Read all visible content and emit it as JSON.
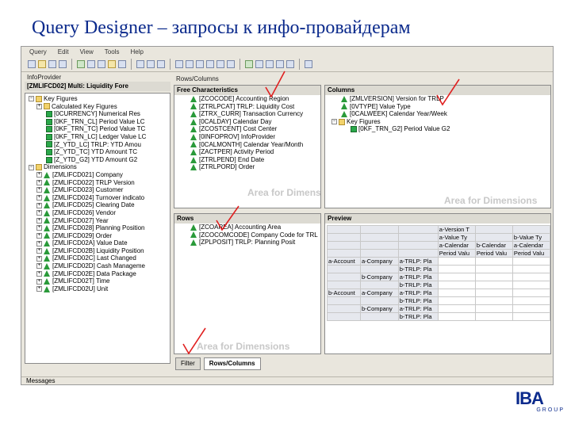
{
  "slide_title": "Query Designer – запросы к инфо-провайдерам",
  "menu": [
    "Query",
    "Edit",
    "View",
    "Tools",
    "Help"
  ],
  "infoprovider": {
    "header": "InfoProvider",
    "title": "[ZMLIFCD02] Multi: Liquidity Fore",
    "key_figures_label": "Key Figures",
    "key_figures": [
      "Calculated Key Figures",
      "[0CURRENCY] Numerical Res",
      "[0KF_TRN_CL] Period Value LC",
      "[0KF_TRN_TC] Period Value TC",
      "[0KF_TRN_LC] Ledger Value LC",
      "[Z_YTD_LC] TRLP: YTD Amou",
      "[Z_YTD_TC] YTD Amount TC",
      "[Z_YTD_G2] YTD Amount G2"
    ],
    "dimensions_label": "Dimensions",
    "dimensions": [
      "[ZMLIFCD021] Company",
      "[ZMLIFCD022] TRLP Version",
      "[ZMLIFCD023] Customer",
      "[ZMLIFCD024] Turnover indicato",
      "[ZMLIFCD025] Clearing Date",
      "[ZMLIFCD026] Vendor",
      "[ZMLIFCD027] Year",
      "[ZMLIFCD028] Planning Position",
      "[ZMLIFCD029] Order",
      "[ZMLIFCD02A] Value Date",
      "[ZMLIFCD02B] Liquidity Position",
      "[ZMLIFCD02C] Last Changed",
      "[ZMLIFCD02D] Cash Manageme",
      "[ZMLIFCD02E] Data Package",
      "[ZMLIFCD02T] Time",
      "[ZMLIFCD02U] Unit"
    ]
  },
  "rows_columns": {
    "header": "Rows/Columns",
    "free_title": "Free Characteristics",
    "free": [
      "[ZCOCODE] Accounting Region",
      "[ZTRLPCAT] TRLP: Liquidity Cost",
      "[ZTRX_CURR] Transaction Currency",
      "[0CALDAY] Calendar Day",
      "[ZCOSTCENT] Cost Center",
      "[0INFOPROV] InfoProvider",
      "[0CALMONTH] Calendar Year/Month",
      "[ZACTPER] Activity Period",
      "[ZTRLPEND] End Date",
      "[ZTRLPORD] Order"
    ],
    "free_area_label": "Area for Dimensions",
    "columns_title": "Columns",
    "columns": [
      "[ZMLVERSION] Version for TRLP",
      "[0VTYPE] Value Type",
      "[0CALWEEK] Calendar Year/Week"
    ],
    "columns_kf_label": "Key Figures",
    "columns_kf": [
      "[0KF_TRN_G2] Period Value G2"
    ],
    "columns_area_label": "Area for Dimensions",
    "rows_title": "Rows",
    "rows": [
      "[ZCOAREA] Accounting Area",
      "[ZCOCOMCODE] Company Code for TRL",
      "[ZPLPOSIT] TRLP: Planning Posit"
    ],
    "rows_area_label": "Area for Dimensions",
    "preview_title": "Preview"
  },
  "preview": {
    "top": [
      [
        "",
        "",
        "",
        "a-Version T",
        "",
        ""
      ],
      [
        "",
        "",
        "",
        "a-Value Ty",
        "",
        "b-Value Ty"
      ],
      [
        "",
        "",
        "",
        "a-Calendar",
        "b-Calendar",
        "a-Calendar"
      ],
      [
        "",
        "",
        "",
        "Period Valu",
        "Period Valu",
        "Period Valu"
      ]
    ],
    "rows": [
      [
        "a-Account",
        "a-Company",
        "a-TRLP: Pla",
        "",
        "",
        ""
      ],
      [
        "",
        "",
        "b-TRLP: Pla",
        "",
        "",
        ""
      ],
      [
        "",
        "b-Company",
        "a-TRLP: Pla",
        "",
        "",
        ""
      ],
      [
        "",
        "",
        "b-TRLP: Pla",
        "",
        "",
        ""
      ],
      [
        "b-Account",
        "a-Company",
        "a-TRLP: Pla",
        "",
        "",
        ""
      ],
      [
        "",
        "",
        "b-TRLP: Pla",
        "",
        "",
        ""
      ],
      [
        "",
        "b-Company",
        "a-TRLP: Pla",
        "",
        "",
        ""
      ],
      [
        "",
        "",
        "b-TRLP: Pla",
        "",
        "",
        ""
      ]
    ]
  },
  "tabs": [
    "Filter",
    "Rows/Columns"
  ],
  "status": "Messages",
  "logo": {
    "name": "IBA",
    "sub": "GROUP"
  },
  "accent": "#0b2a8c",
  "annotation_color": "#e02020"
}
